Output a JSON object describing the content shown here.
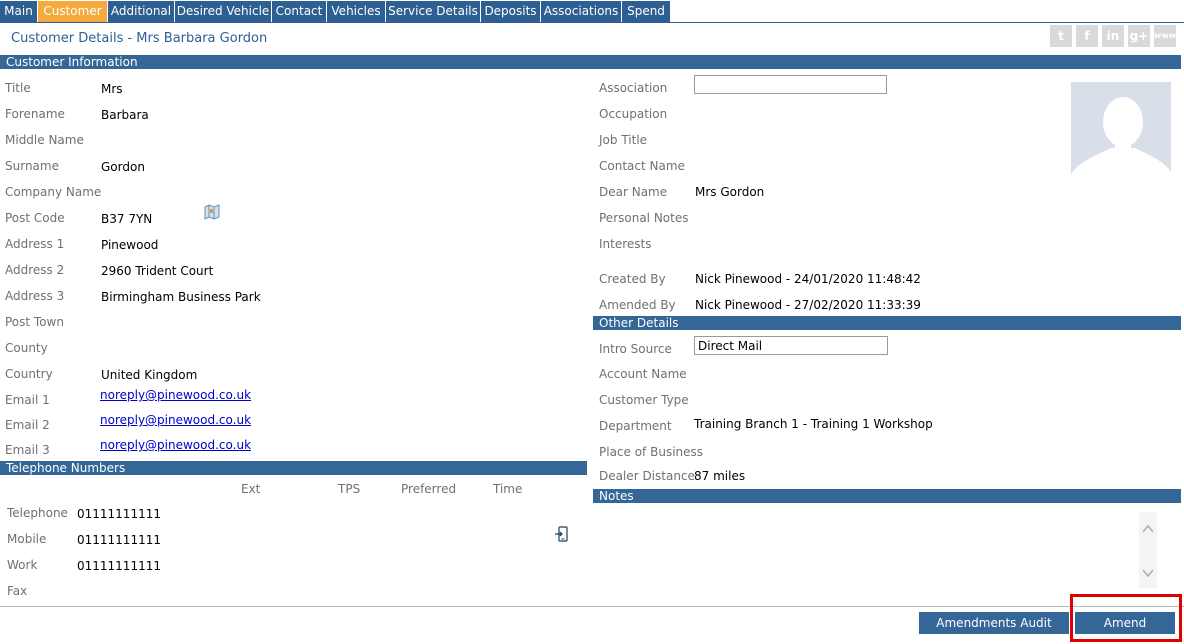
{
  "tabs": [
    {
      "label": "Main"
    },
    {
      "label": "Customer"
    },
    {
      "label": "Additional"
    },
    {
      "label": "Desired Vehicle"
    },
    {
      "label": "Contact"
    },
    {
      "label": "Vehicles"
    },
    {
      "label": "Service Details"
    },
    {
      "label": "Deposits"
    },
    {
      "label": "Associations"
    },
    {
      "label": "Spend"
    }
  ],
  "active_tab": "Customer",
  "header": {
    "title": "Customer Details - Mrs Barbara Gordon",
    "social_icons": [
      "twitter-icon",
      "facebook-icon",
      "linkedin-icon",
      "google-plus-icon",
      "www-icon"
    ],
    "social_glyphs": {
      "twitter": "t",
      "facebook": "f",
      "linkedin": "in",
      "google_plus": "g+",
      "www": "www"
    }
  },
  "sections": {
    "customer_info": "Customer Information",
    "telephone": "Telephone Numbers",
    "other_details": "Other Details",
    "notes": "Notes"
  },
  "customer": {
    "title": {
      "label": "Title",
      "value": "Mrs"
    },
    "forename": {
      "label": "Forename",
      "value": "Barbara"
    },
    "middle_name": {
      "label": "Middle Name",
      "value": ""
    },
    "surname": {
      "label": "Surname",
      "value": "Gordon"
    },
    "company_name": {
      "label": "Company Name",
      "value": ""
    },
    "post_code": {
      "label": "Post Code",
      "value": "B37 7YN"
    },
    "address1": {
      "label": "Address 1",
      "value": "Pinewood"
    },
    "address2": {
      "label": "Address 2",
      "value": "2960 Trident Court"
    },
    "address3": {
      "label": "Address 3",
      "value": "Birmingham Business Park"
    },
    "post_town": {
      "label": "Post Town",
      "value": ""
    },
    "county": {
      "label": "County",
      "value": ""
    },
    "country": {
      "label": "Country",
      "value": "United Kingdom"
    },
    "email1": {
      "label": "Email 1",
      "value": "noreply@pinewood.co.uk"
    },
    "email2": {
      "label": "Email 2",
      "value": "noreply@pinewood.co.uk"
    },
    "email3": {
      "label": "Email 3",
      "value": "noreply@pinewood.co.uk"
    }
  },
  "right": {
    "association": {
      "label": "Association",
      "value": ""
    },
    "occupation": {
      "label": "Occupation",
      "value": ""
    },
    "job_title": {
      "label": "Job Title",
      "value": ""
    },
    "contact_name": {
      "label": "Contact Name",
      "value": ""
    },
    "dear_name": {
      "label": "Dear Name",
      "value": "Mrs Gordon"
    },
    "personal_notes": {
      "label": "Personal Notes",
      "value": ""
    },
    "interests": {
      "label": "Interests",
      "value": ""
    },
    "created_by": {
      "label": "Created By",
      "value": "Nick Pinewood - 24/01/2020 11:48:42"
    },
    "amended_by": {
      "label": "Amended By",
      "value": "Nick Pinewood - 27/02/2020 11:33:39"
    }
  },
  "other": {
    "intro_source": {
      "label": "Intro Source",
      "value": "Direct Mail"
    },
    "account_name": {
      "label": "Account Name",
      "value": ""
    },
    "customer_type": {
      "label": "Customer Type",
      "value": ""
    },
    "department": {
      "label": "Department",
      "value": "Training Branch 1 - Training 1 Workshop"
    },
    "place_of_business": {
      "label": "Place of Business",
      "value": ""
    },
    "dealer_distance": {
      "label": "Dealer Distance",
      "value": "87 miles"
    }
  },
  "telephone": {
    "columns": [
      "Ext",
      "TPS",
      "Preferred",
      "Time"
    ],
    "rows": [
      {
        "label": "Telephone",
        "number": "01111111111"
      },
      {
        "label": "Mobile",
        "number": "01111111111"
      },
      {
        "label": "Work",
        "number": "01111111111"
      },
      {
        "label": "Fax",
        "number": ""
      }
    ]
  },
  "buttons": {
    "amendments_audit": "Amendments Audit",
    "amend": "Amend"
  },
  "colors": {
    "brand_blue": "#2d5f92",
    "active_tab": "#f6a93c",
    "highlight": "#e00000"
  }
}
